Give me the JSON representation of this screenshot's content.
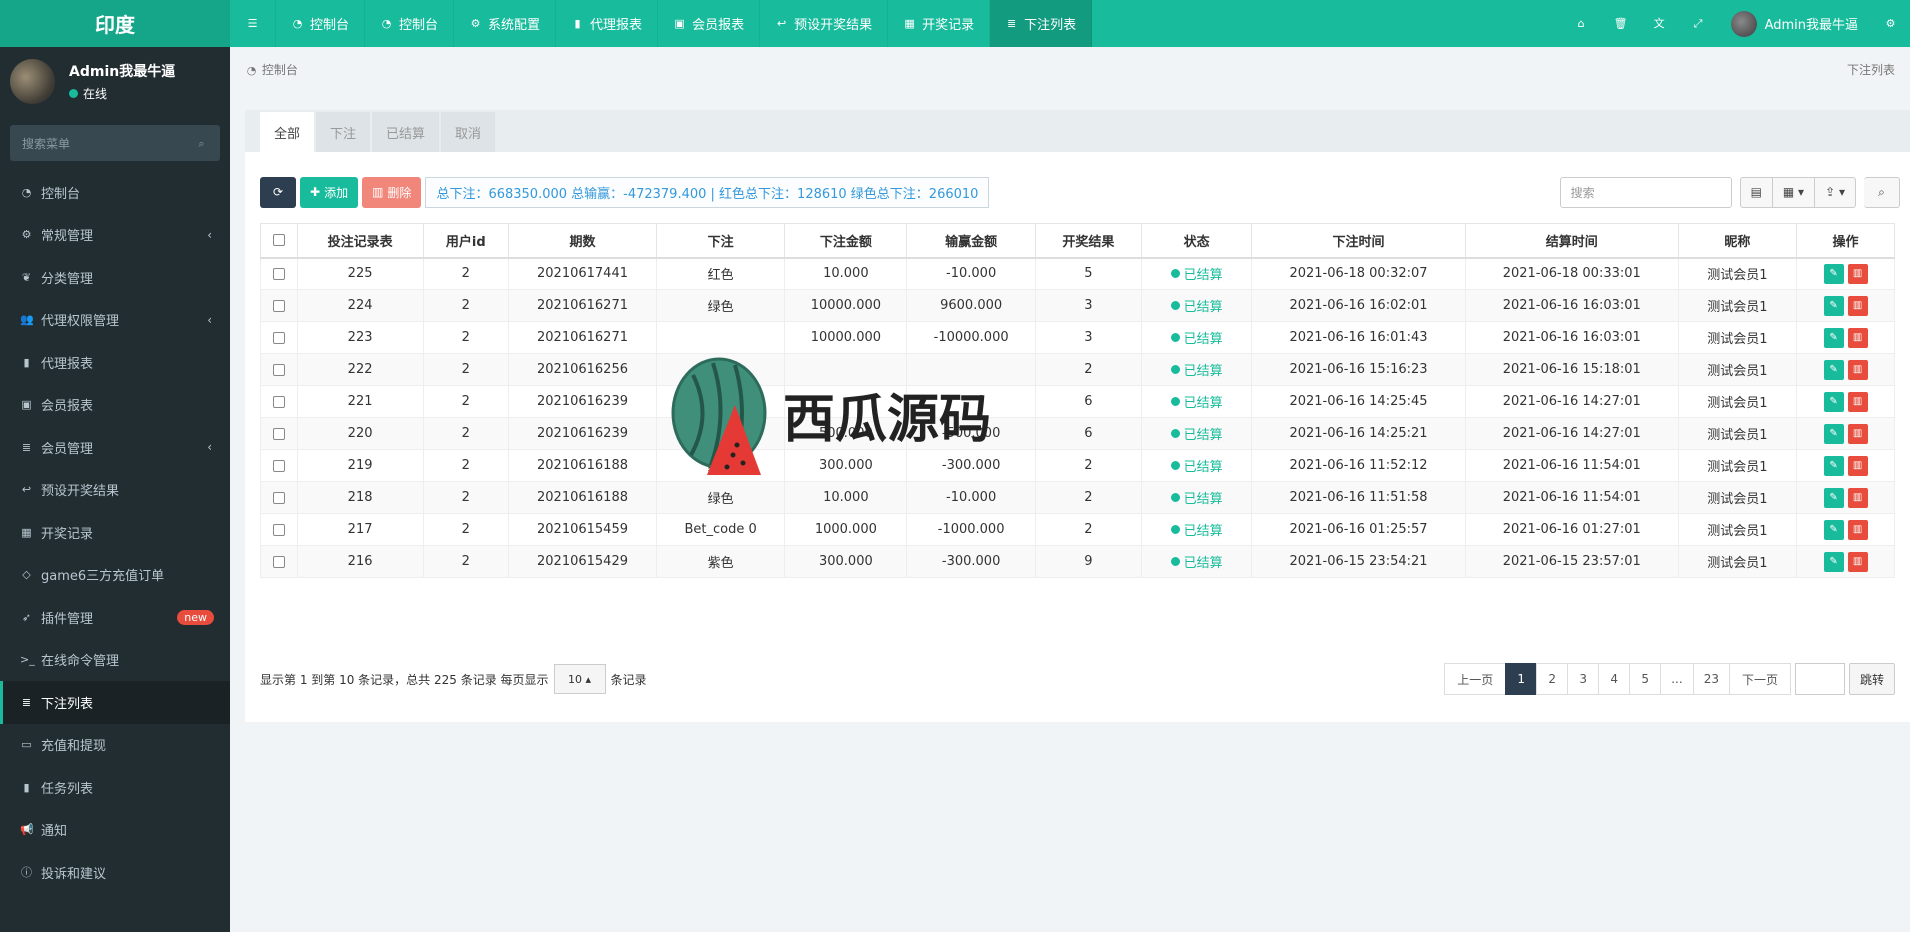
{
  "brand": "印度",
  "top_nav": [
    {
      "icon": "dashboard-icon",
      "label": "控制台"
    },
    {
      "icon": "dashboard-icon",
      "label": "控制台"
    },
    {
      "icon": "gear-icon",
      "label": "系统配置"
    },
    {
      "icon": "book-icon",
      "label": "代理报表"
    },
    {
      "icon": "id-card-icon",
      "label": "会员报表"
    },
    {
      "icon": "reply-icon",
      "label": "预设开奖结果"
    },
    {
      "icon": "calendar-check-icon",
      "label": "开奖记录"
    },
    {
      "icon": "list-icon",
      "label": "下注列表"
    }
  ],
  "top_user": "Admin我最牛逼",
  "user": {
    "name": "Admin我最牛逼",
    "status": "在线"
  },
  "side_search_placeholder": "搜索菜单",
  "sidebar": [
    {
      "icon": "dashboard-icon",
      "label": "控制台",
      "arrow": false
    },
    {
      "icon": "cogs-icon",
      "label": "常规管理",
      "arrow": true
    },
    {
      "icon": "leaf-icon",
      "label": "分类管理",
      "arrow": false
    },
    {
      "icon": "users-icon",
      "label": "代理权限管理",
      "arrow": true
    },
    {
      "icon": "book-icon",
      "label": "代理报表",
      "arrow": false
    },
    {
      "icon": "id-card-icon",
      "label": "会员报表",
      "arrow": false
    },
    {
      "icon": "list-icon",
      "label": "会员管理",
      "arrow": true
    },
    {
      "icon": "reply-icon",
      "label": "预设开奖结果",
      "arrow": false
    },
    {
      "icon": "calendar-check-icon",
      "label": "开奖记录",
      "arrow": false
    },
    {
      "icon": "diamond-icon",
      "label": "game6三方充值订单",
      "arrow": false
    },
    {
      "icon": "rocket-icon",
      "label": "插件管理",
      "badge": "new"
    },
    {
      "icon": "terminal-icon",
      "label": "在线命令管理",
      "arrow": false
    },
    {
      "icon": "list-icon",
      "label": "下注列表",
      "active": true
    },
    {
      "icon": "money-icon",
      "label": "充值和提现",
      "arrow": false
    },
    {
      "icon": "book-icon",
      "label": "任务列表",
      "arrow": false
    },
    {
      "icon": "bullhorn-icon",
      "label": "通知",
      "arrow": false
    },
    {
      "icon": "info-icon",
      "label": "投诉和建议",
      "arrow": false
    }
  ],
  "breadcrumb": {
    "left": "控制台",
    "right": "下注列表"
  },
  "tabs": [
    "全部",
    "下注",
    "已结算",
    "取消"
  ],
  "toolbar": {
    "add_label": "添加",
    "delete_label": "删除",
    "summary": "总下注：668350.000 总输赢：-472379.400 | 红色总下注：128610 绿色总下注：266010",
    "search_placeholder": "搜索"
  },
  "table": {
    "headers": [
      "投注记录表",
      "用户id",
      "期数",
      "下注",
      "下注金额",
      "输赢金额",
      "开奖结果",
      "状态",
      "下注时间",
      "结算时间",
      "昵称",
      "操作"
    ],
    "rows": [
      {
        "id": "225",
        "uid": "2",
        "period": "20210617441",
        "bet": "红色",
        "bet_color": "green",
        "amount": "10.000",
        "winloss": "-10.000",
        "result": "5",
        "status": "已结算",
        "bet_time": "2021-06-18 00:32:07",
        "settle_time": "2021-06-18 00:33:01",
        "nick": "测试会员1"
      },
      {
        "id": "224",
        "uid": "2",
        "period": "20210616271",
        "bet": "绿色",
        "bet_color": "normal",
        "amount": "10000.000",
        "winloss": "9600.000",
        "result": "3",
        "status": "已结算",
        "bet_time": "2021-06-16 16:02:01",
        "settle_time": "2021-06-16 16:03:01",
        "nick": "测试会员1"
      },
      {
        "id": "223",
        "uid": "2",
        "period": "20210616271",
        "bet": "",
        "bet_color": "normal",
        "amount": "10000.000",
        "winloss": "-10000.000",
        "result": "3",
        "status": "已结算",
        "bet_time": "2021-06-16 16:01:43",
        "settle_time": "2021-06-16 16:03:01",
        "nick": "测试会员1"
      },
      {
        "id": "222",
        "uid": "2",
        "period": "20210616256",
        "bet": "",
        "bet_color": "normal",
        "amount": "",
        "winloss": "",
        "result": "2",
        "status": "已结算",
        "bet_time": "2021-06-16 15:16:23",
        "settle_time": "2021-06-16 15:18:01",
        "nick": "测试会员1"
      },
      {
        "id": "221",
        "uid": "2",
        "period": "20210616239",
        "bet": "",
        "bet_color": "normal",
        "amount": "",
        "winloss": "",
        "result": "6",
        "status": "已结算",
        "bet_time": "2021-06-16 14:25:45",
        "settle_time": "2021-06-16 14:27:01",
        "nick": "测试会员1"
      },
      {
        "id": "220",
        "uid": "2",
        "period": "20210616239",
        "bet": "",
        "bet_color": "green",
        "amount": "500.000",
        "winloss": "-500.000",
        "result": "6",
        "status": "已结算",
        "bet_time": "2021-06-16 14:25:21",
        "settle_time": "2021-06-16 14:27:01",
        "nick": "测试会员1"
      },
      {
        "id": "219",
        "uid": "2",
        "period": "20210616188",
        "bet": "绿色",
        "bet_color": "normal",
        "amount": "300.000",
        "winloss": "-300.000",
        "result": "2",
        "status": "已结算",
        "bet_time": "2021-06-16 11:52:12",
        "settle_time": "2021-06-16 11:54:01",
        "nick": "测试会员1"
      },
      {
        "id": "218",
        "uid": "2",
        "period": "20210616188",
        "bet": "绿色",
        "bet_color": "normal",
        "amount": "10.000",
        "winloss": "-10.000",
        "result": "2",
        "status": "已结算",
        "bet_time": "2021-06-16 11:51:58",
        "settle_time": "2021-06-16 11:54:01",
        "nick": "测试会员1"
      },
      {
        "id": "217",
        "uid": "2",
        "period": "20210615459",
        "bet": "Bet_code 0",
        "bet_color": "normal",
        "amount": "1000.000",
        "winloss": "-1000.000",
        "result": "2",
        "status": "已结算",
        "bet_time": "2021-06-16 01:25:57",
        "settle_time": "2021-06-16 01:27:01",
        "nick": "测试会员1"
      },
      {
        "id": "216",
        "uid": "2",
        "period": "20210615429",
        "bet": "紫色",
        "bet_color": "green",
        "amount": "300.000",
        "winloss": "-300.000",
        "result": "9",
        "status": "已结算",
        "bet_time": "2021-06-15 23:54:21",
        "settle_time": "2021-06-15 23:57:01",
        "nick": "测试会员1"
      }
    ]
  },
  "footer": {
    "info_prefix": "显示第 1 到第 10 条记录，总共 225 条记录 每页显示",
    "page_size": "10",
    "info_suffix": "条记录",
    "prev": "上一页",
    "pages": [
      "1",
      "2",
      "3",
      "4",
      "5",
      "...",
      "23"
    ],
    "next": "下一页",
    "jump": "跳转"
  },
  "watermark_text": "西瓜源码",
  "colors": {
    "accent": "#18bc9c",
    "sidebar": "#222d32",
    "danger": "#e74c3c",
    "dark": "#2c3e50"
  }
}
